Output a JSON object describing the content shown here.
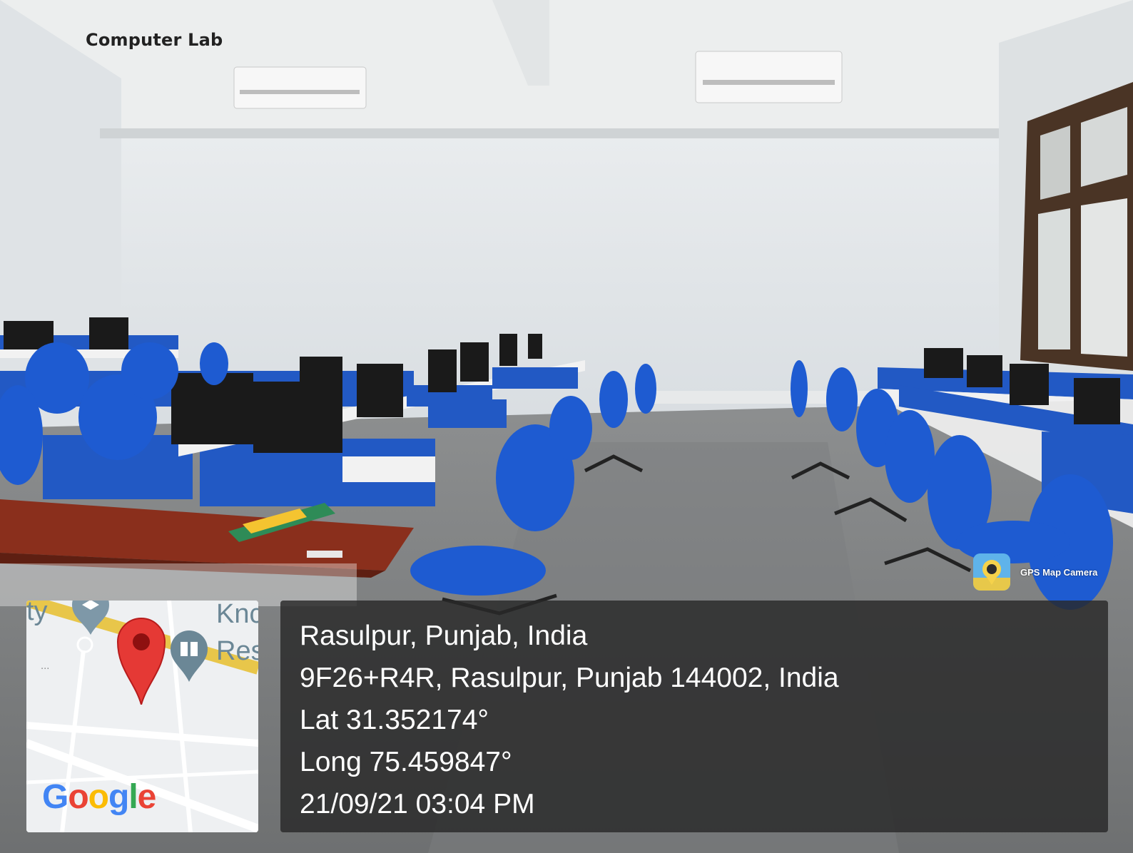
{
  "caption": "Computer Lab",
  "location": {
    "title": "Rasulpur, Punjab, India",
    "address": "9F26+R4R, Rasulpur, Punjab 144002, India",
    "lat": "Lat 31.352174°",
    "long": "Long 75.459847°",
    "datetime": "21/09/21 03:04 PM"
  },
  "app": {
    "name": "GPS Map Camera",
    "icon": "camera-pin-icon"
  },
  "map": {
    "provider": "Google",
    "poi_text_1": "Knc",
    "poi_text_2": "Res",
    "poi_text_3": "ty",
    "marker_icon": "map-pin-icon",
    "poi_icon": "book-place-icon",
    "marker_color": "#e53935",
    "poi_color": "#6b8796"
  },
  "colors": {
    "chair_blue": "#1e5bd1",
    "panel_blue": "#2259c4",
    "desk_top": "#f2f2f2",
    "table_wood": "#8a2f1c"
  }
}
